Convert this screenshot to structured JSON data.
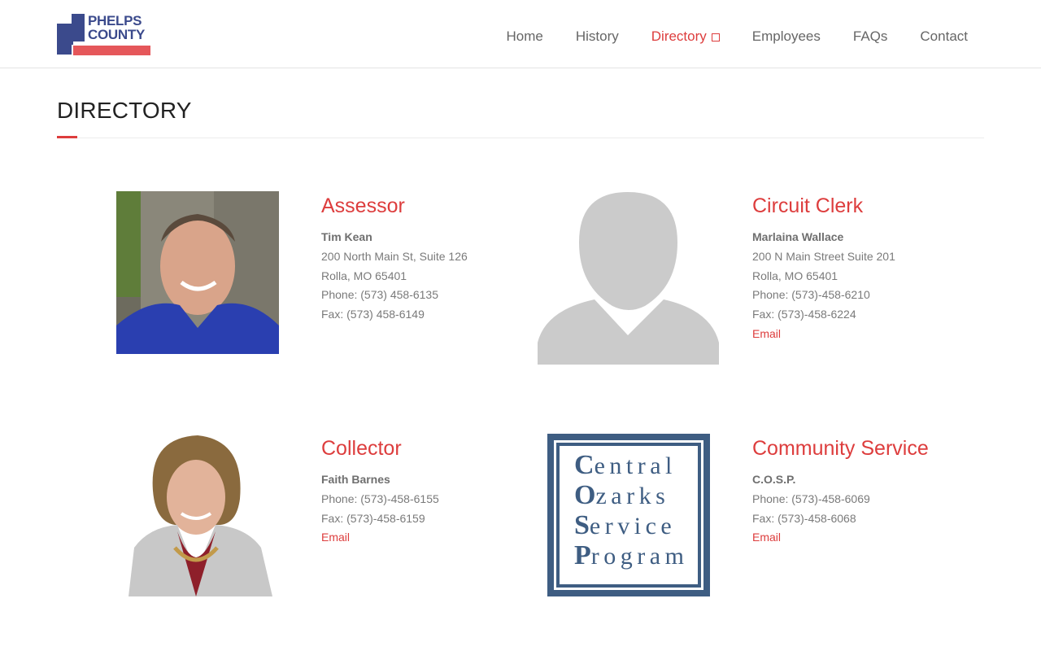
{
  "header": {
    "logo": {
      "line1": "PHELPS",
      "line2": "COUNTY"
    },
    "nav": [
      {
        "label": "Home",
        "active": false
      },
      {
        "label": "History",
        "active": false
      },
      {
        "label": "Directory",
        "active": true
      },
      {
        "label": "Employees",
        "active": false
      },
      {
        "label": "FAQs",
        "active": false
      },
      {
        "label": "Contact",
        "active": false
      }
    ]
  },
  "page": {
    "title": "DIRECTORY"
  },
  "directory": [
    {
      "dept": "Assessor",
      "name": "Tim Kean",
      "address1": "200 North Main St, Suite 126",
      "address2": "Rolla, MO 65401",
      "phone": "Phone: (573) 458-6135",
      "fax": "Fax: (573) 458-6149",
      "email": ""
    },
    {
      "dept": "Circuit Clerk",
      "name": "Marlaina Wallace",
      "address1": "200 N Main Street Suite 201",
      "address2": "Rolla, MO 65401",
      "phone": "Phone: (573)-458-6210",
      "fax": "Fax: (573)-458-6224",
      "email": "Email"
    },
    {
      "dept": "Collector",
      "name": "Faith Barnes",
      "phone": "Phone: (573)-458-6155",
      "fax": "Fax: (573)-458-6159",
      "email": "Email"
    },
    {
      "dept": "Community Service",
      "name": "C.O.S.P.",
      "phone": "Phone: (573)-458-6069",
      "fax": "Fax: (573)-458-6068",
      "email": "Email",
      "logo_words": [
        {
          "initial": "C",
          "rest": "entral"
        },
        {
          "initial": "O",
          "rest": "zarks"
        },
        {
          "initial": "S",
          "rest": "ervice"
        },
        {
          "initial": "P",
          "rest": "rogram"
        }
      ]
    }
  ],
  "colors": {
    "accent": "#dd3d3d",
    "logo_blue": "#3b4a8c",
    "logo_red": "#e5575a",
    "cosp_blue": "#3e5d82"
  }
}
